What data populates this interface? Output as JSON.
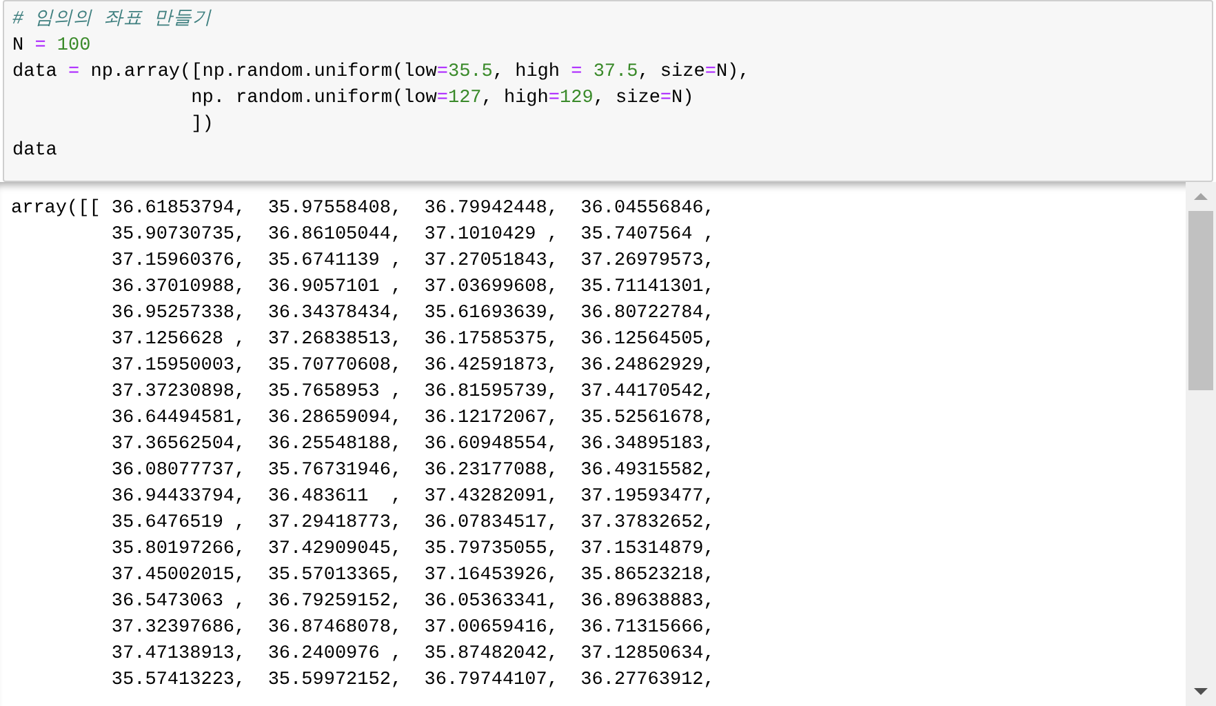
{
  "code_cell": {
    "lines": [
      [
        {
          "kind": "comment",
          "text": "# 임의의 좌표 만들기"
        }
      ],
      [
        {
          "kind": "text",
          "text": "N "
        },
        {
          "kind": "op",
          "text": "="
        },
        {
          "kind": "num",
          "text": " 100"
        }
      ],
      [
        {
          "kind": "text",
          "text": "data "
        },
        {
          "kind": "op",
          "text": "="
        },
        {
          "kind": "text",
          "text": " np.array([np.random.uniform(low"
        },
        {
          "kind": "op",
          "text": "="
        },
        {
          "kind": "num",
          "text": "35.5"
        },
        {
          "kind": "text",
          "text": ", high "
        },
        {
          "kind": "op",
          "text": "="
        },
        {
          "kind": "num",
          "text": " 37.5"
        },
        {
          "kind": "text",
          "text": ", size"
        },
        {
          "kind": "op",
          "text": "="
        },
        {
          "kind": "text",
          "text": "N),"
        }
      ],
      [
        {
          "kind": "text",
          "text": "                np. random.uniform(low"
        },
        {
          "kind": "op",
          "text": "="
        },
        {
          "kind": "num",
          "text": "127"
        },
        {
          "kind": "text",
          "text": ", high"
        },
        {
          "kind": "op",
          "text": "="
        },
        {
          "kind": "num",
          "text": "129"
        },
        {
          "kind": "text",
          "text": ", size"
        },
        {
          "kind": "op",
          "text": "="
        },
        {
          "kind": "text",
          "text": "N)"
        }
      ],
      [
        {
          "kind": "text",
          "text": "                ])"
        }
      ],
      [
        {
          "kind": "text",
          "text": "data"
        }
      ]
    ]
  },
  "output": {
    "lines": [
      "array([[ 36.61853794,  35.97558408,  36.79942448,  36.04556846,",
      "         35.90730735,  36.86105044,  37.1010429 ,  35.7407564 ,",
      "         37.15960376,  35.6741139 ,  37.27051843,  37.26979573,",
      "         36.37010988,  36.9057101 ,  37.03699608,  35.71141301,",
      "         36.95257338,  36.34378434,  35.61693639,  36.80722784,",
      "         37.1256628 ,  37.26838513,  36.17585375,  36.12564505,",
      "         37.15950003,  35.70770608,  36.42591873,  36.24862929,",
      "         37.37230898,  35.7658953 ,  36.81595739,  37.44170542,",
      "         36.64494581,  36.28659094,  36.12172067,  35.52561678,",
      "         37.36562504,  36.25548188,  36.60948554,  36.34895183,",
      "         36.08077737,  35.76731946,  36.23177088,  36.49315582,",
      "         36.94433794,  36.483611  ,  37.43282091,  37.19593477,",
      "         35.6476519 ,  37.29418773,  36.07834517,  37.37832652,",
      "         35.80197266,  37.42909045,  35.79735055,  37.15314879,",
      "         37.45002015,  35.57013365,  37.16453926,  35.86523218,",
      "         36.5473063 ,  36.79259152,  36.05363341,  36.89638883,",
      "         37.32397686,  36.87468078,  37.00659416,  36.71315666,",
      "         37.47138913,  36.2400976 ,  35.87482042,  37.12850634,",
      "         35.57413223,  35.59972152,  36.79744107,  36.27763912,"
    ]
  }
}
